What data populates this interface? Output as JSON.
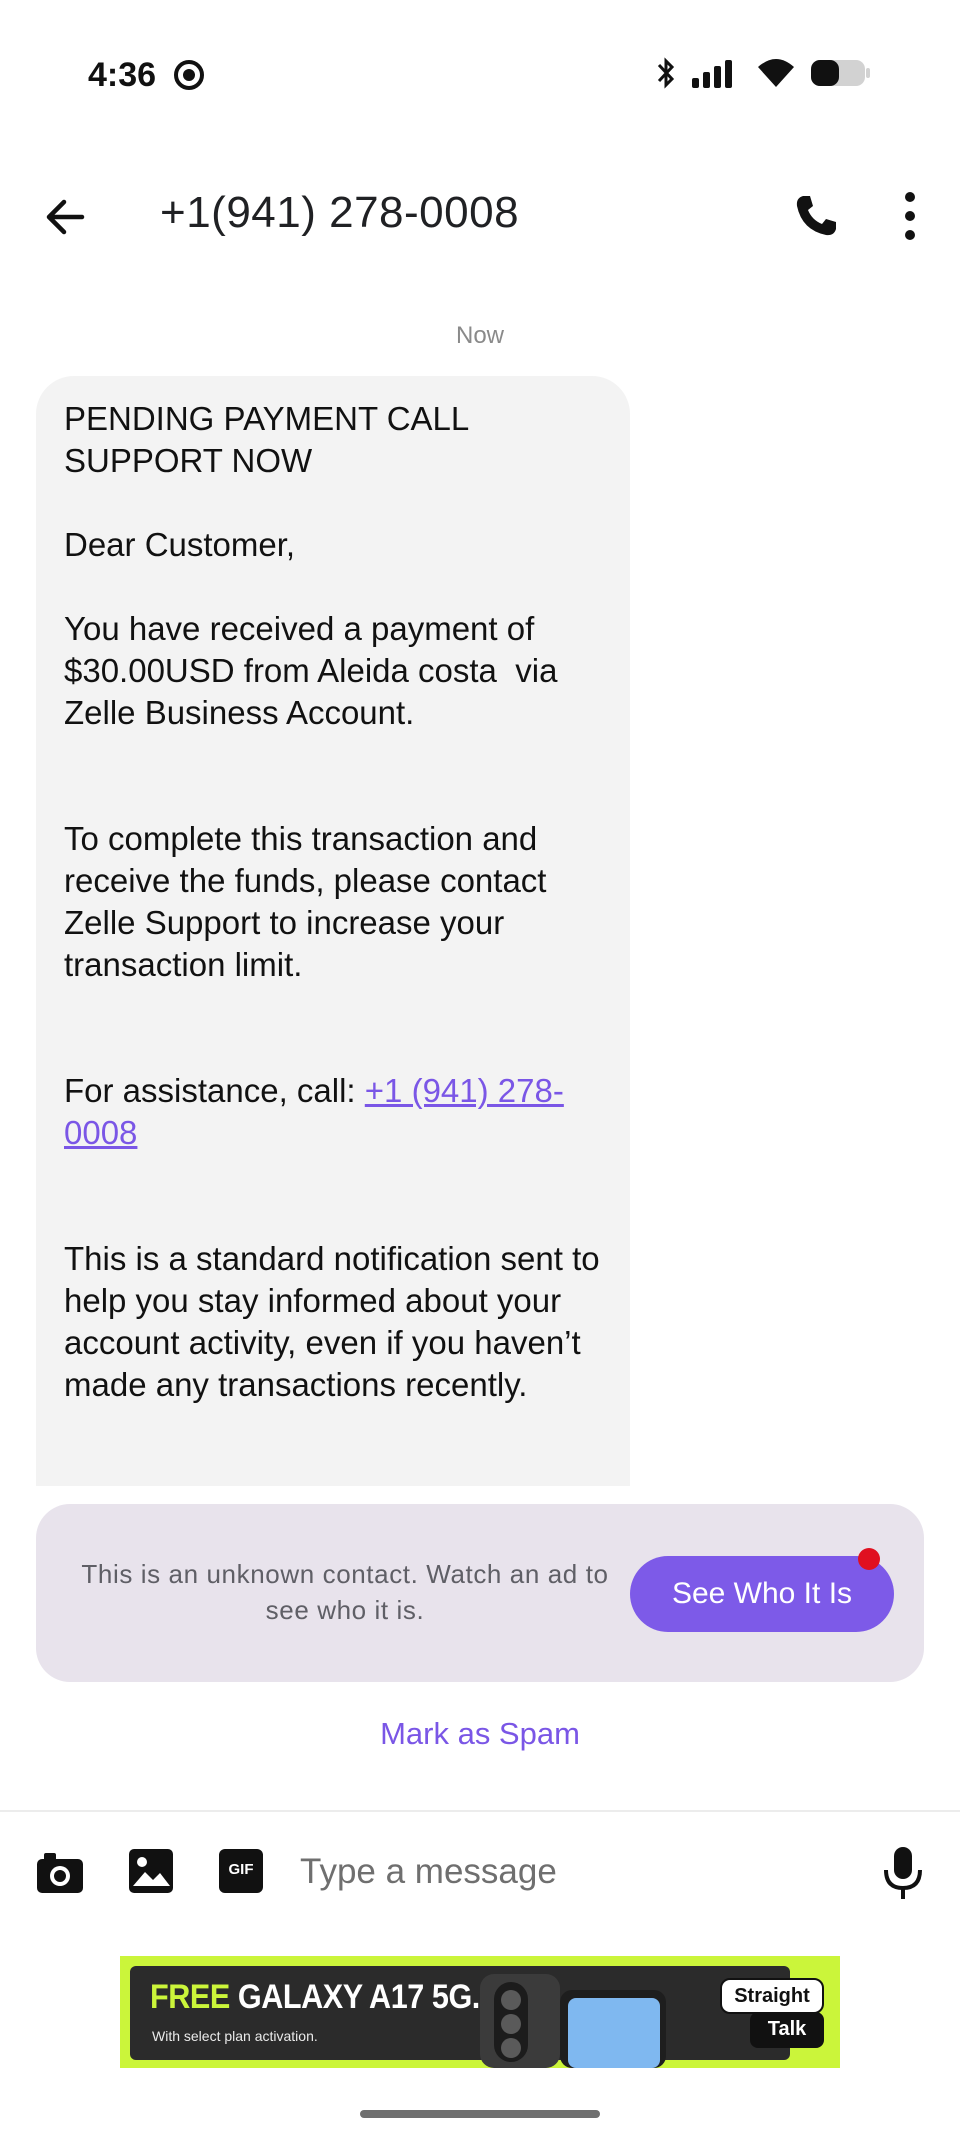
{
  "status_bar": {
    "time": "4:36"
  },
  "header": {
    "title": "+1(941) 278-0008"
  },
  "conversation": {
    "timestamp": "Now",
    "message": {
      "part1": "PENDING PAYMENT CALL SUPPORT NOW\n\nDear Customer,\n\nYou have received a payment of $30.00USD from Aleida costa  via Zelle Business Account.\n\n\nTo complete this transaction and receive the funds, please contact Zelle Support to increase your transaction limit.\n\n\nFor assistance, call: ",
      "link": "+1 (941) 278-0008",
      "part2": "\n\n\nThis is a standard notification sent to help you stay informed about your account activity, even if you haven’t made any transactions recently."
    }
  },
  "unknown_contact": {
    "text": "This is an unknown contact. Watch an ad to see who it is.",
    "button_label": "See Who It Is"
  },
  "spam_link_label": "Mark as Spam",
  "composer": {
    "placeholder": "Type a message",
    "gif_label": "GIF"
  },
  "ad": {
    "free": "FREE",
    "headline_rest": " GALAXY A17 5G.",
    "subtext": "With select plan activation.",
    "brand_top": "Straight",
    "brand_bottom": "Talk"
  },
  "colors": {
    "accent": "#7d5ae8",
    "link": "#7a56e6",
    "bubble": "#f3f3f3",
    "panel": "#e8e3ec",
    "ad_green": "#cbf53a"
  }
}
